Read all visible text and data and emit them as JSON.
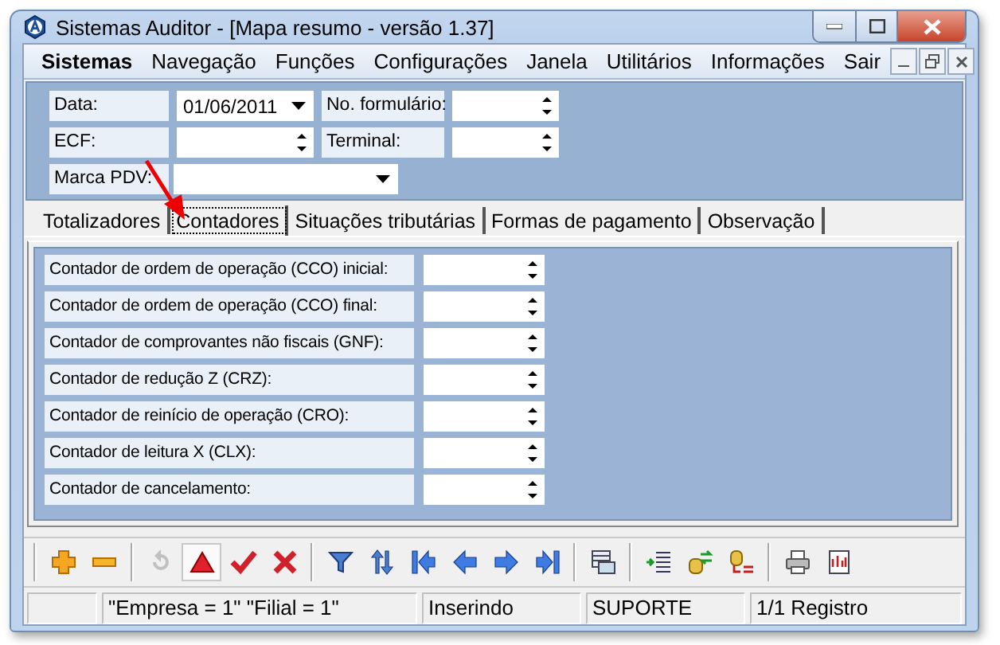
{
  "window": {
    "title": "Sistemas Auditor - [Mapa resumo - versão 1.37]"
  },
  "menu": {
    "app": "Sistemas",
    "items": [
      "Navegação",
      "Funções",
      "Configurações",
      "Janela",
      "Utilitários",
      "Informações",
      "Sair"
    ]
  },
  "form": {
    "rows": [
      [
        {
          "label": "Data:",
          "kind": "dropdown",
          "value": "01/06/2011"
        },
        {
          "label": "No. formulário:",
          "kind": "spinner"
        }
      ],
      [
        {
          "label": "ECF:",
          "kind": "spinner"
        },
        {
          "label": "Terminal:",
          "kind": "spinner"
        }
      ],
      [
        {
          "label": "Marca PDV:",
          "kind": "combo"
        }
      ]
    ]
  },
  "tabs": [
    {
      "label": "Totalizadores",
      "selected": false
    },
    {
      "label": "Contadores",
      "selected": true
    },
    {
      "label": "Situações tributárias",
      "selected": false
    },
    {
      "label": "Formas de pagamento",
      "selected": false
    },
    {
      "label": "Observação",
      "selected": false
    }
  ],
  "counters": [
    {
      "label": "Contador de ordem de operação (CCO) inicial:"
    },
    {
      "label": "Contador de ordem de operação (CCO) final:"
    },
    {
      "label": "Contador de comprovantes não fiscais (GNF):"
    },
    {
      "label": "Contador de redução Z (CRZ):"
    },
    {
      "label": "Contador de reinício de operação (CRO):"
    },
    {
      "label": "Contador de leitura X (CLX):"
    },
    {
      "label": "Contador de cancelamento:"
    }
  ],
  "toolbar": [
    [
      {
        "disabled": false,
        "selected": false
      },
      {
        "disabled": false,
        "selected": false
      }
    ],
    [
      {
        "disabled": true,
        "selected": false
      },
      {
        "disabled": false,
        "selected": true
      },
      {
        "disabled": false,
        "selected": false
      },
      {
        "disabled": false,
        "selected": false
      }
    ],
    [
      {
        "disabled": false,
        "selected": false
      },
      {
        "disabled": false,
        "selected": false
      },
      {
        "disabled": false,
        "selected": false
      },
      {
        "disabled": false,
        "selected": false
      },
      {
        "disabled": false,
        "selected": false
      },
      {
        "disabled": false,
        "selected": false
      }
    ],
    [
      {
        "disabled": false,
        "selected": false
      }
    ],
    [
      {
        "disabled": false,
        "selected": false
      },
      {
        "disabled": false,
        "selected": false
      },
      {
        "disabled": false,
        "selected": false
      }
    ],
    [
      {
        "disabled": false,
        "selected": false
      },
      {
        "disabled": false,
        "selected": false
      }
    ]
  ],
  "status_bar": [
    "\"Empresa = 1\"   \"Filial = 1\"",
    "Inserindo",
    "SUPORTE",
    "1/1 Registro"
  ]
}
